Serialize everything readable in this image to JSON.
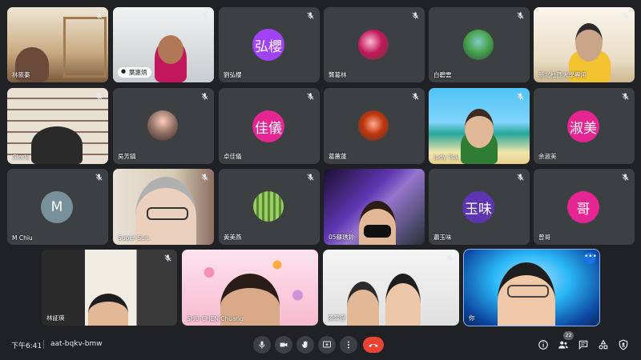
{
  "colors": {
    "background": "#202124",
    "tile": "#3c4043",
    "accent_blue": "#8ab4f8",
    "hangup_red": "#ea4335"
  },
  "participants": [
    {
      "name": "林筱蓁"
    },
    {
      "name": "葉惠炳",
      "speaking_label": "葉惠炳"
    },
    {
      "name": "劉弘櫻",
      "avatar_text": "弘櫻",
      "avatar_color": "#a142f4"
    },
    {
      "name": "龔葛林"
    },
    {
      "name": "白碧雲"
    },
    {
      "name": "新北社區大學專用"
    },
    {
      "name": "Gloria"
    },
    {
      "name": "吳芳鎮"
    },
    {
      "name": "卓佳儀",
      "avatar_text": "佳儀",
      "avatar_color": "#e52592"
    },
    {
      "name": "葛蕙蓮"
    },
    {
      "name": "Judy Tsai"
    },
    {
      "name": "余淑美",
      "avatar_text": "淑美",
      "avatar_color": "#e52592"
    },
    {
      "name": "M Chiu",
      "avatar_text": "M",
      "avatar_color": "#78909c"
    },
    {
      "name": "Super Sun_"
    },
    {
      "name": "黃美燕"
    },
    {
      "name": "05蘇琇鈴"
    },
    {
      "name": "蕭玉味",
      "avatar_text": "玉味",
      "avatar_color": "#5e35b1"
    },
    {
      "name": "曾哥",
      "avatar_text": "哥",
      "avatar_color": "#e52592"
    },
    {
      "name": "林証瑛"
    },
    {
      "name": "SHU-CHEN Chuang"
    },
    {
      "name": "陳翠霞"
    },
    {
      "name": "你"
    }
  ],
  "bottom_bar": {
    "time": "下午6:41",
    "meeting_code": "aat-bqkv-bmw",
    "participant_count": "22",
    "controls": [
      "mic-icon",
      "camera-icon",
      "raise-hand-icon",
      "present-icon",
      "more-icon",
      "hangup-icon"
    ],
    "right_icons": [
      "info-icon",
      "people-icon",
      "chat-icon",
      "activities-icon",
      "host-controls-icon"
    ]
  }
}
